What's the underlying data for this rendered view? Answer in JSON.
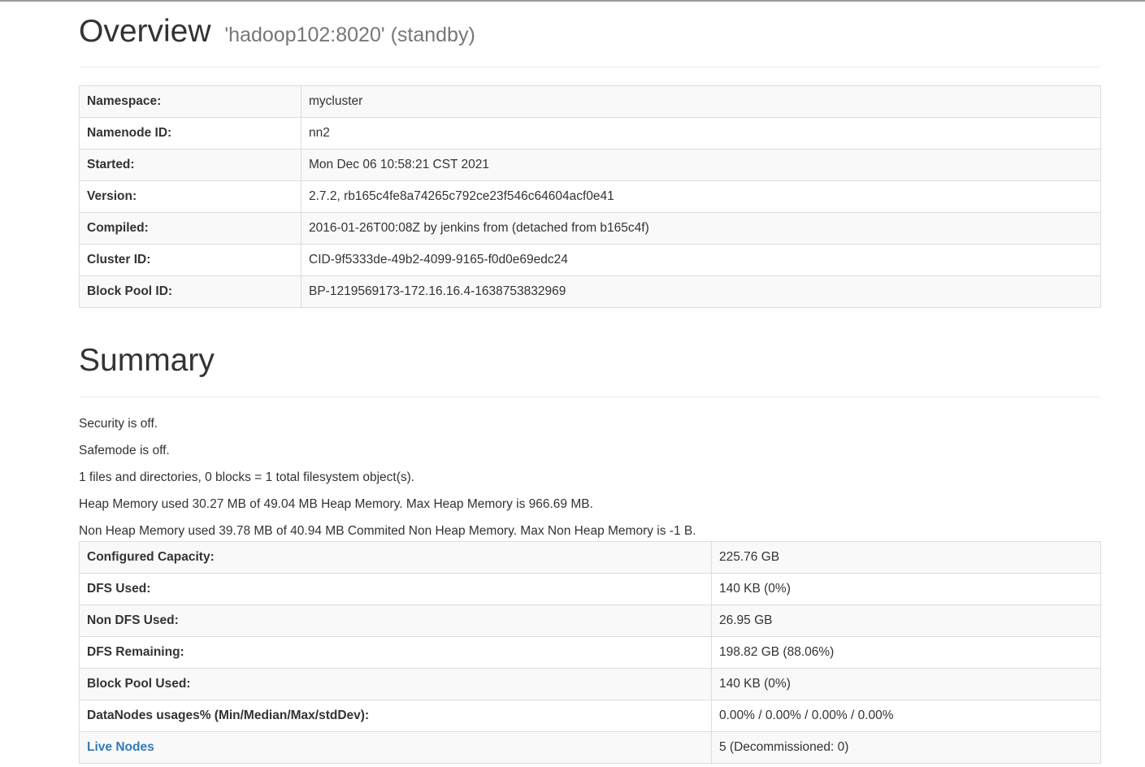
{
  "overview": {
    "title": "Overview",
    "subtitle": "'hadoop102:8020' (standby)",
    "rows": [
      {
        "label": "Namespace:",
        "value": "mycluster"
      },
      {
        "label": "Namenode ID:",
        "value": "nn2"
      },
      {
        "label": "Started:",
        "value": "Mon Dec 06 10:58:21 CST 2021"
      },
      {
        "label": "Version:",
        "value": "2.7.2, rb165c4fe8a74265c792ce23f546c64604acf0e41"
      },
      {
        "label": "Compiled:",
        "value": "2016-01-26T00:08Z by jenkins from (detached from b165c4f)"
      },
      {
        "label": "Cluster ID:",
        "value": "CID-9f5333de-49b2-4099-9165-f0d0e69edc24"
      },
      {
        "label": "Block Pool ID:",
        "value": "BP-1219569173-172.16.16.4-1638753832969"
      }
    ]
  },
  "summary": {
    "title": "Summary",
    "lines": [
      "Security is off.",
      "Safemode is off.",
      "1 files and directories, 0 blocks = 1 total filesystem object(s).",
      "Heap Memory used 30.27 MB of 49.04 MB Heap Memory. Max Heap Memory is 966.69 MB.",
      "Non Heap Memory used 39.78 MB of 40.94 MB Commited Non Heap Memory. Max Non Heap Memory is -1 B."
    ],
    "rows": [
      {
        "label": "Configured Capacity:",
        "value": "225.76 GB"
      },
      {
        "label": "DFS Used:",
        "value": "140 KB (0%)"
      },
      {
        "label": "Non DFS Used:",
        "value": "26.95 GB"
      },
      {
        "label": "DFS Remaining:",
        "value": "198.82 GB (88.06%)"
      },
      {
        "label": "Block Pool Used:",
        "value": "140 KB (0%)"
      },
      {
        "label": "DataNodes usages% (Min/Median/Max/stdDev):",
        "value": "0.00% / 0.00% / 0.00% / 0.00%"
      },
      {
        "label": "Live Nodes",
        "value": "5 (Decommissioned: 0)"
      }
    ]
  },
  "colors": {
    "link": "#337ab7",
    "text": "#333333",
    "muted": "#777777",
    "border": "#dddddd",
    "stripe": "#f9f9f9"
  }
}
